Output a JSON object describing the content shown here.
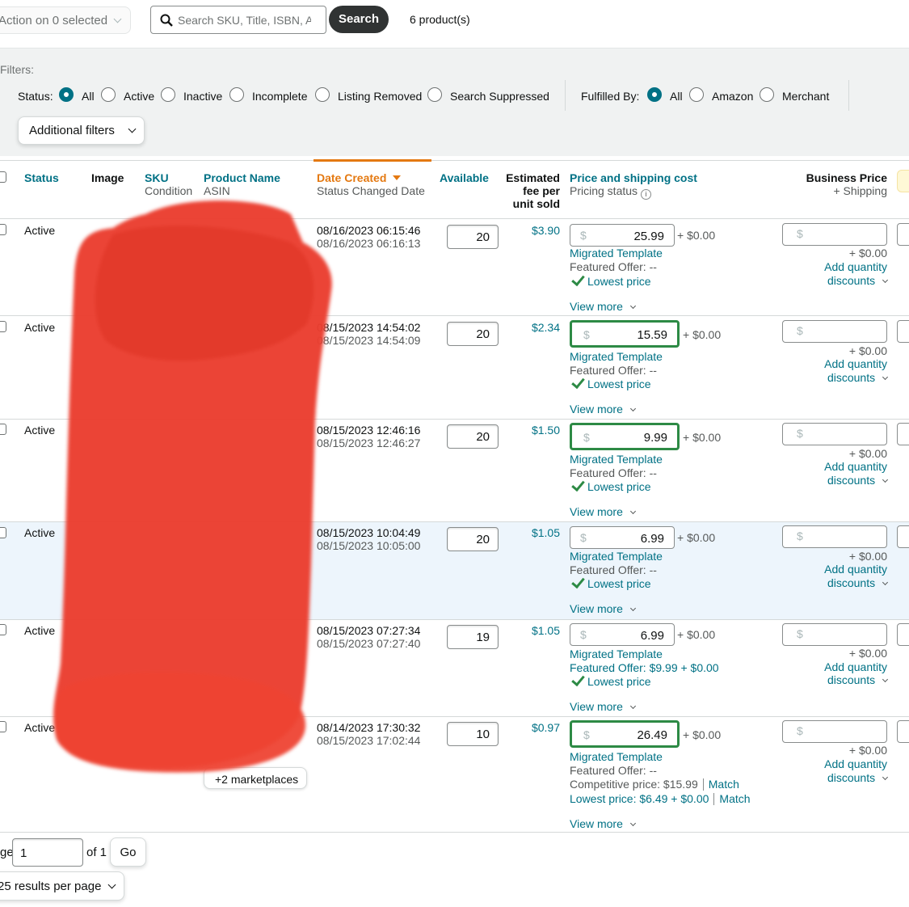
{
  "toolbar": {
    "action_label": "Action on 0 selected",
    "search_placeholder": "Search SKU, Title, ISBN, AS",
    "search_button": "Search",
    "product_count": "6 product(s)"
  },
  "filters": {
    "heading": "Filters:",
    "status_label": "Status:",
    "status_options": [
      "All",
      "Active",
      "Inactive",
      "Incomplete",
      "Listing Removed",
      "Search Suppressed"
    ],
    "status_selected": "All",
    "fulfilled_label": "Fulfilled By:",
    "fulfilled_options": [
      "All",
      "Amazon",
      "Merchant"
    ],
    "fulfilled_selected": "All",
    "additional_filters": "Additional filters"
  },
  "columns": {
    "status": "Status",
    "image": "Image",
    "sku": "SKU",
    "condition": "Condition",
    "product_name": "Product Name",
    "asin": "ASIN",
    "date_created": "Date Created",
    "status_changed": "Status Changed Date",
    "available": "Available",
    "fee_line1": "Estimated",
    "fee_line2": "fee per",
    "fee_line3": "unit sold",
    "price": "Price and shipping cost",
    "pricing_status": "Pricing status",
    "business_price": "Business Price",
    "business_shipping": "+ Shipping"
  },
  "row_labels": {
    "shipping": "+ $0.00",
    "template": "Migrated Template",
    "lowest": "Lowest price",
    "view_more": "View more",
    "add_qty": "Add quantity",
    "discounts": "discounts",
    "dollar": "$",
    "match": "Match"
  },
  "rows": [
    {
      "status": "Active",
      "date_created": "08/16/2023 06:15:46",
      "status_changed": "08/16/2023 06:16:13",
      "available": "20",
      "fee": "$3.90",
      "price": "25.99",
      "featured": "Featured Offer: --"
    },
    {
      "status": "Active",
      "date_created": "08/15/2023 14:54:02",
      "status_changed": "08/15/2023 14:54:09",
      "available": "20",
      "fee": "$2.34",
      "price": "15.59",
      "featured": "Featured Offer: --"
    },
    {
      "status": "Active",
      "date_created": "08/15/2023 12:46:16",
      "status_changed": "08/15/2023 12:46:27",
      "available": "20",
      "fee": "$1.50",
      "price": "9.99",
      "featured": "Featured Offer: --"
    },
    {
      "status": "Active",
      "date_created": "08/15/2023 10:04:49",
      "status_changed": "08/15/2023 10:05:00",
      "available": "20",
      "fee": "$1.05",
      "price": "6.99",
      "featured": "Featured Offer: --"
    },
    {
      "status": "Active",
      "date_created": "08/15/2023 07:27:34",
      "status_changed": "08/15/2023 07:27:40",
      "available": "19",
      "fee": "$1.05",
      "price": "6.99",
      "featured": "Featured Offer: $9.99 + $0.00"
    },
    {
      "status": "Active",
      "date_created": "08/14/2023 17:30:32",
      "status_changed": "08/15/2023 17:02:44",
      "available": "10",
      "fee": "$0.97",
      "price": "26.49",
      "featured": "Featured Offer: --",
      "competitive": "Competitive price: $15.99",
      "lowest_offer": "Lowest price: $6.49 + $0.00",
      "marketplaces": "+2 marketplaces"
    }
  ],
  "pagination": {
    "page_label": "ge",
    "page_value": "1",
    "of_label": "of 1",
    "go_button": "Go",
    "per_page": "25 results per page"
  },
  "colors": {
    "link": "#007185",
    "sort_active": "#e47911",
    "selected_row": "#edf5fc",
    "green_outline": "#2d8a45",
    "redaction": "#ea3e2f"
  }
}
